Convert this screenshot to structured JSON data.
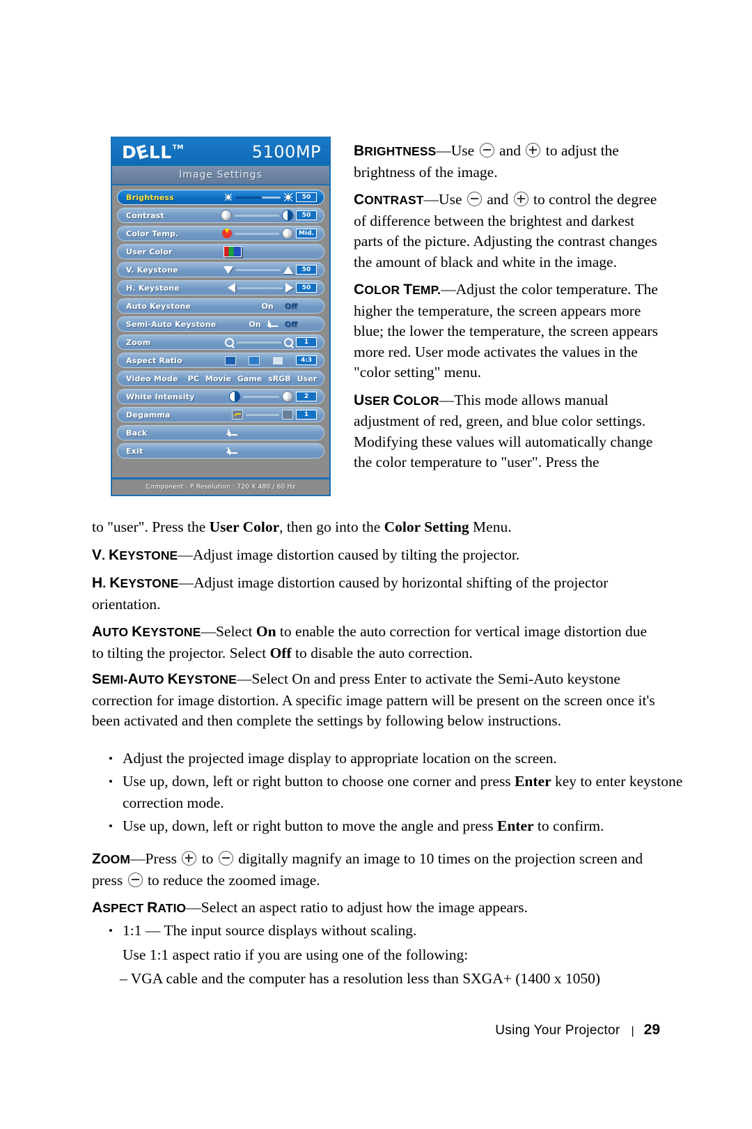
{
  "osd": {
    "brand": "DELL",
    "trademark": "TM",
    "model": "5100MP",
    "menu_title": "Image Settings",
    "rows": [
      {
        "label": "Brightness",
        "value": "50",
        "selected": true
      },
      {
        "label": "Contrast",
        "value": "50",
        "selected": false
      },
      {
        "label": "Color Temp.",
        "value": "Mid.",
        "selected": false
      },
      {
        "label": "User Color",
        "value": "",
        "selected": false
      },
      {
        "label": "V. Keystone",
        "value": "50",
        "selected": false
      },
      {
        "label": "H. Keystone",
        "value": "50",
        "selected": false
      },
      {
        "label": "Auto Keystone",
        "on": "On",
        "off": "Off",
        "selected": false
      },
      {
        "label": "Semi-Auto Keystone",
        "on": "On",
        "off": "Off",
        "selected": false
      },
      {
        "label": "Zoom",
        "value": "1",
        "selected": false
      },
      {
        "label": "Aspect Ratio",
        "value": "4:3",
        "selected": false
      },
      {
        "label": "Video Mode",
        "modes": [
          "PC",
          "Movie",
          "Game",
          "sRGB",
          "User"
        ],
        "selected": false
      },
      {
        "label": "White Intensity",
        "value": "2",
        "selected": false
      },
      {
        "label": "Degamma",
        "value": "1",
        "selected": false
      },
      {
        "label": "Back",
        "value": "",
        "selected": false
      },
      {
        "label": "Exit",
        "value": "",
        "selected": false
      }
    ],
    "status": "Component - P Resolution : 720 X 480 / 60 Hz",
    "colors": {
      "header_blue": "#1277c4",
      "row_blue": "#7fa5cc",
      "row_selected_blue": "#0e6fc2",
      "selected_label_yellow": "#ffe23c",
      "body_gray": "#8c8c8c",
      "border_blue": "#1a6fb5"
    }
  },
  "content": {
    "brightness": {
      "term": "Brightness",
      "text_a": "Use ",
      "text_b": " and ",
      "text_c": " to adjust the brightness of the image."
    },
    "contrast": {
      "term": "Contrast",
      "text_a": "Use ",
      "text_b": " and ",
      "text_c": " to control the degree of difference between the brightest and darkest parts of the picture. Adjusting the contrast changes the amount of black and white in the image."
    },
    "color_temp": {
      "term": "Color Temp.",
      "text": "Adjust the color temperature. The higher the temperature, the screen appears more blue; the lower the temperature, the screen appears more red. User mode activates the values in the \"color setting\" menu."
    },
    "user_color": {
      "term": "User Color",
      "text_a": "This mode allows manual adjustment of red, green, and blue color settings. Modifying these values will automatically change the color temperature to \"user\". Press the ",
      "bold_a": "User Color",
      "text_b": ", then go into the ",
      "bold_b": "Color Setting",
      "text_c": " Menu."
    },
    "v_keystone": {
      "term": "V. Keystone",
      "text": "Adjust image distortion caused by tilting the projector."
    },
    "h_keystone": {
      "term": "H. Keystone",
      "text": "Adjust image distortion caused by horizontal shifting of the projector orientation."
    },
    "auto_keystone": {
      "term": "Auto Keystone",
      "text_a": "Select ",
      "bold_a": "On",
      "text_b": " to enable the auto correction for vertical image distortion due to tilting the projector. Select ",
      "bold_b": "Off",
      "text_c": " to disable the auto correction."
    },
    "semi_auto_keystone": {
      "term": "Semi-Auto Keystone",
      "text": "Select On and press Enter to activate the Semi-Auto keystone correction for image distortion. A specific image pattern will be present on the screen once it's been activated and then complete the settings by following below instructions.",
      "bullets": [
        {
          "a": "Adjust the projected image display to appropriate location on the screen.",
          "bold": "",
          "b": ""
        },
        {
          "a": "Use up, down, left or right button to choose one corner and press ",
          "bold": "Enter",
          "b": " key to enter keystone correction mode."
        },
        {
          "a": "Use up, down, left or right button to move the angle and press ",
          "bold": "Enter",
          "b": " to confirm."
        }
      ]
    },
    "zoom": {
      "term": "Zoom",
      "text_a": "Press ",
      "text_b": " to ",
      "text_c": " digitally magnify an image to 10 times on the projection screen and press ",
      "text_d": " to reduce the zoomed image."
    },
    "aspect_ratio": {
      "term": "Aspect Ratio",
      "text": "Select an aspect ratio to adjust how the image appears.",
      "bullet_1": "1:1 — The input source displays without scaling.",
      "sub_1": "Use 1:1 aspect ratio if you are using one of the following:",
      "dash_1": "– VGA cable and the computer has a resolution less than SXGA+ (1400 x 1050)"
    }
  },
  "footer": {
    "chapter": "Using Your Projector",
    "separator": "|",
    "page": "29"
  }
}
